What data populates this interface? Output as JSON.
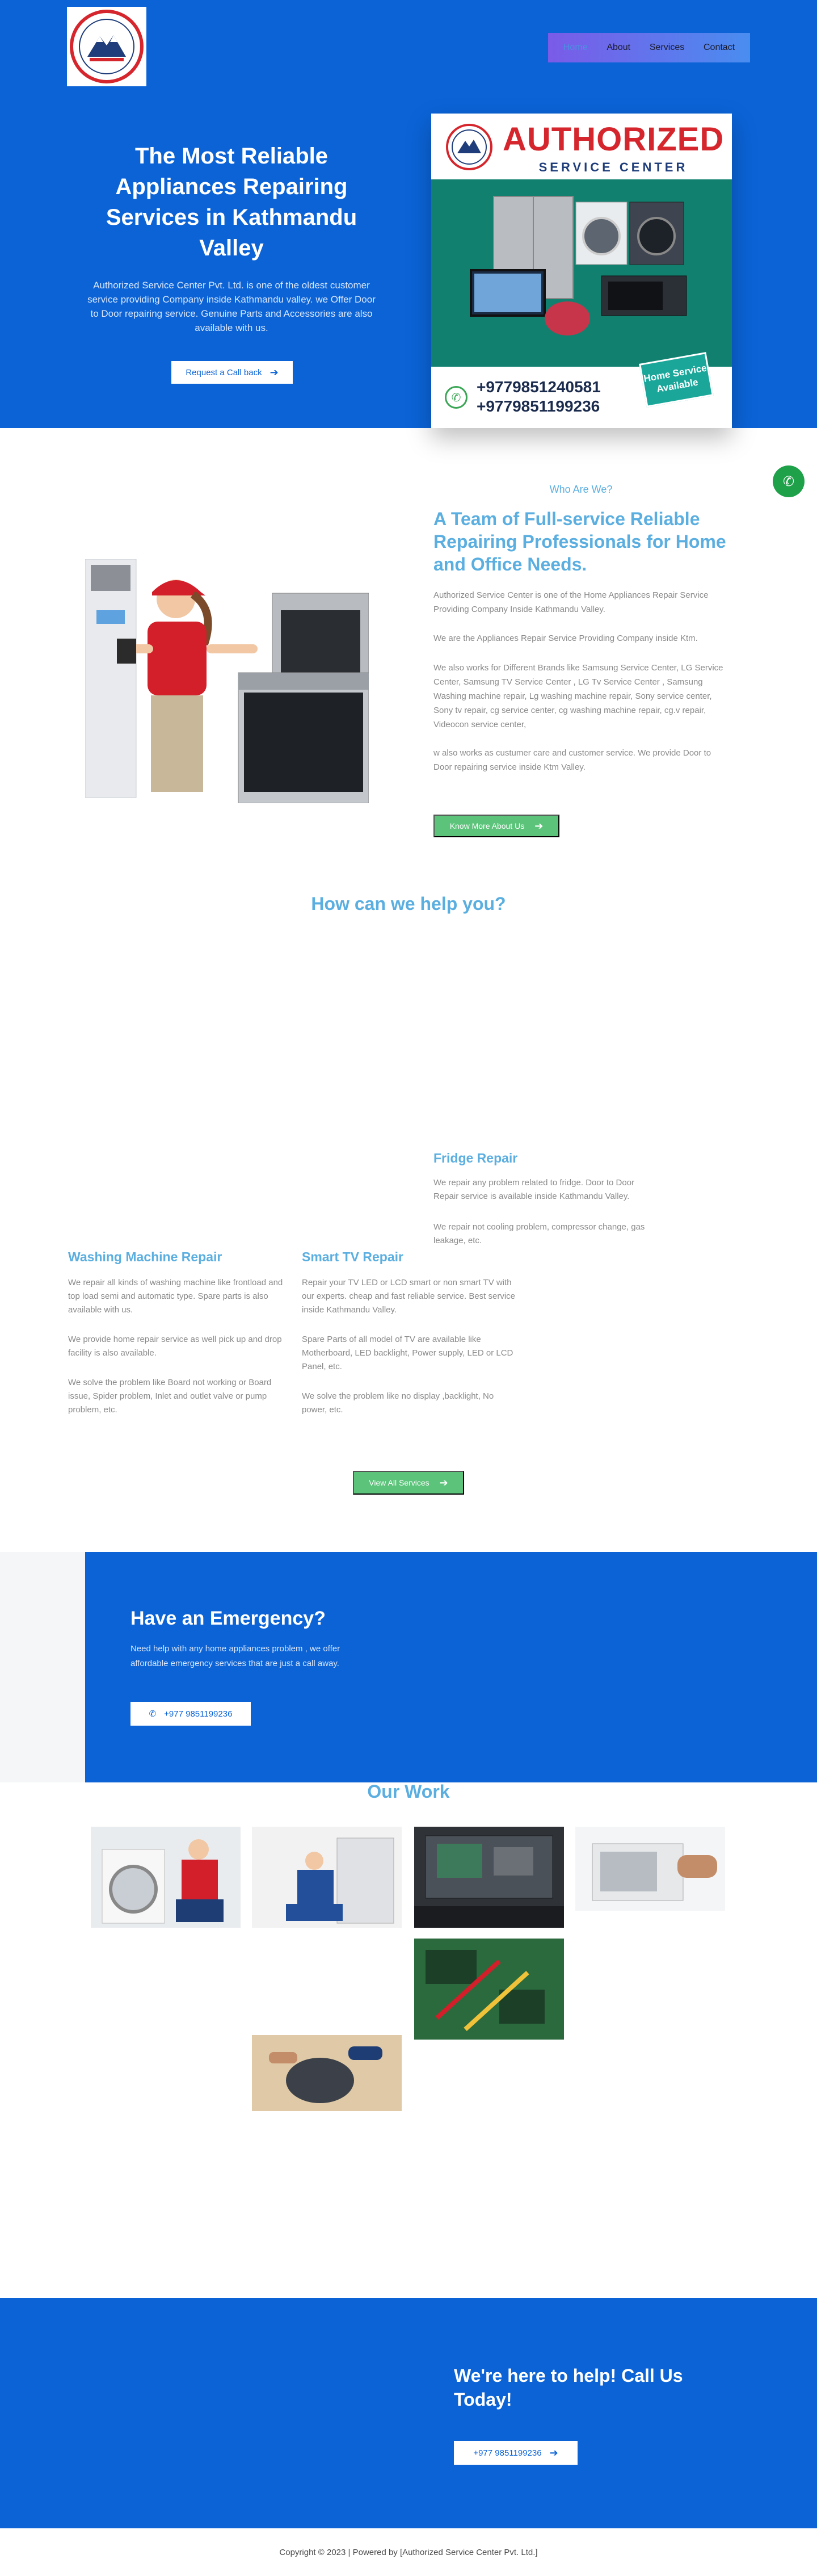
{
  "header": {
    "logo_text": "AUTHORIZED SERVICE CENTER",
    "nav": [
      "Home",
      "About",
      "Services",
      "Contact"
    ]
  },
  "hero": {
    "title": "The Most Reliable Appliances Repairing Services in Kathmandu Valley",
    "text": "Authorized Service Center Pvt. Ltd. is one of the oldest customer service providing Company inside Kathmandu valley. we Offer Door to Door repairing service. Genuine Parts and Accessories are also available with us.",
    "button": "Request a Call back",
    "card": {
      "title": "AUTHORIZED",
      "subtitle": "SERVICE CENTER",
      "phone1": "+9779851240581",
      "phone2": "+9779851199236",
      "badge": "Home Service Available"
    }
  },
  "about": {
    "kicker": "Who Are We?",
    "title": "A Team of Full-service Reliable Repairing Professionals for Home and Office Needs.",
    "paragraphs": [
      "Authorized Service Center is one of the Home Appliances Repair Service Providing Company Inside Kathmandu Valley.",
      "We are the Appliances Repair Service Providing Company inside Ktm.",
      "We also works for Different Brands like Samsung Service Center, LG Service Center, Samsung TV Service Center , LG Tv Service Center , Samsung Washing machine repair, Lg washing machine repair, Sony service center, Sony tv repair, cg service center, cg washing machine repair, cg.v repair, Videocon service center,",
      "w also works as custumer care and customer service. We provide Door to Door repairing service inside Ktm Valley."
    ],
    "button": "Know More About Us"
  },
  "services": {
    "title": "How can we help you?",
    "items": [
      {
        "title": "Washing Machine Repair",
        "paragraphs": [
          "We repair all kinds of washing machine like frontload and top load semi and automatic type. Spare parts is also available with us.",
          "We provide home repair service as well pick up and drop facility is also available.",
          "We solve the problem like Board not working or Board issue, Spider problem, Inlet and outlet valve or pump problem, etc."
        ]
      },
      {
        "title": "Smart TV Repair",
        "paragraphs": [
          "Repair your TV LED or LCD smart or non smart TV with our experts. cheap and fast reliable service. Best service inside Kathmandu Valley.",
          "Spare Parts of all model of TV are available like Motherboard, LED backlight, Power supply, LED or LCD Panel, etc.",
          "We solve the problem like no display ,backlight, No power, etc."
        ]
      },
      {
        "title": "Fridge Repair",
        "paragraphs": [
          "We repair any problem related to fridge. Door to Door Repair service is available inside Kathmandu Valley.",
          "We repair not cooling problem, compressor change, gas leakage, etc."
        ]
      }
    ],
    "button": "View All Services"
  },
  "emergency": {
    "title": "Have an Emergency?",
    "text": "Need help with any home appliances problem , we offer affordable emergency services that are just a call away.",
    "button": "+977 9851199236"
  },
  "work": {
    "title": "Our Work"
  },
  "cta": {
    "title": "We're here to help! Call Us Today!",
    "button": "+977 9851199236"
  },
  "footer": {
    "text": "Copyright © 2023 | Powered by [Authorized Service Center Pvt. Ltd.]"
  },
  "colors": {
    "primary_blue": "#0b63d6",
    "accent_light_blue": "#5aaee0",
    "green_button": "#5cc37a",
    "call_green": "#1fa14a",
    "brand_red": "#d6262d"
  }
}
